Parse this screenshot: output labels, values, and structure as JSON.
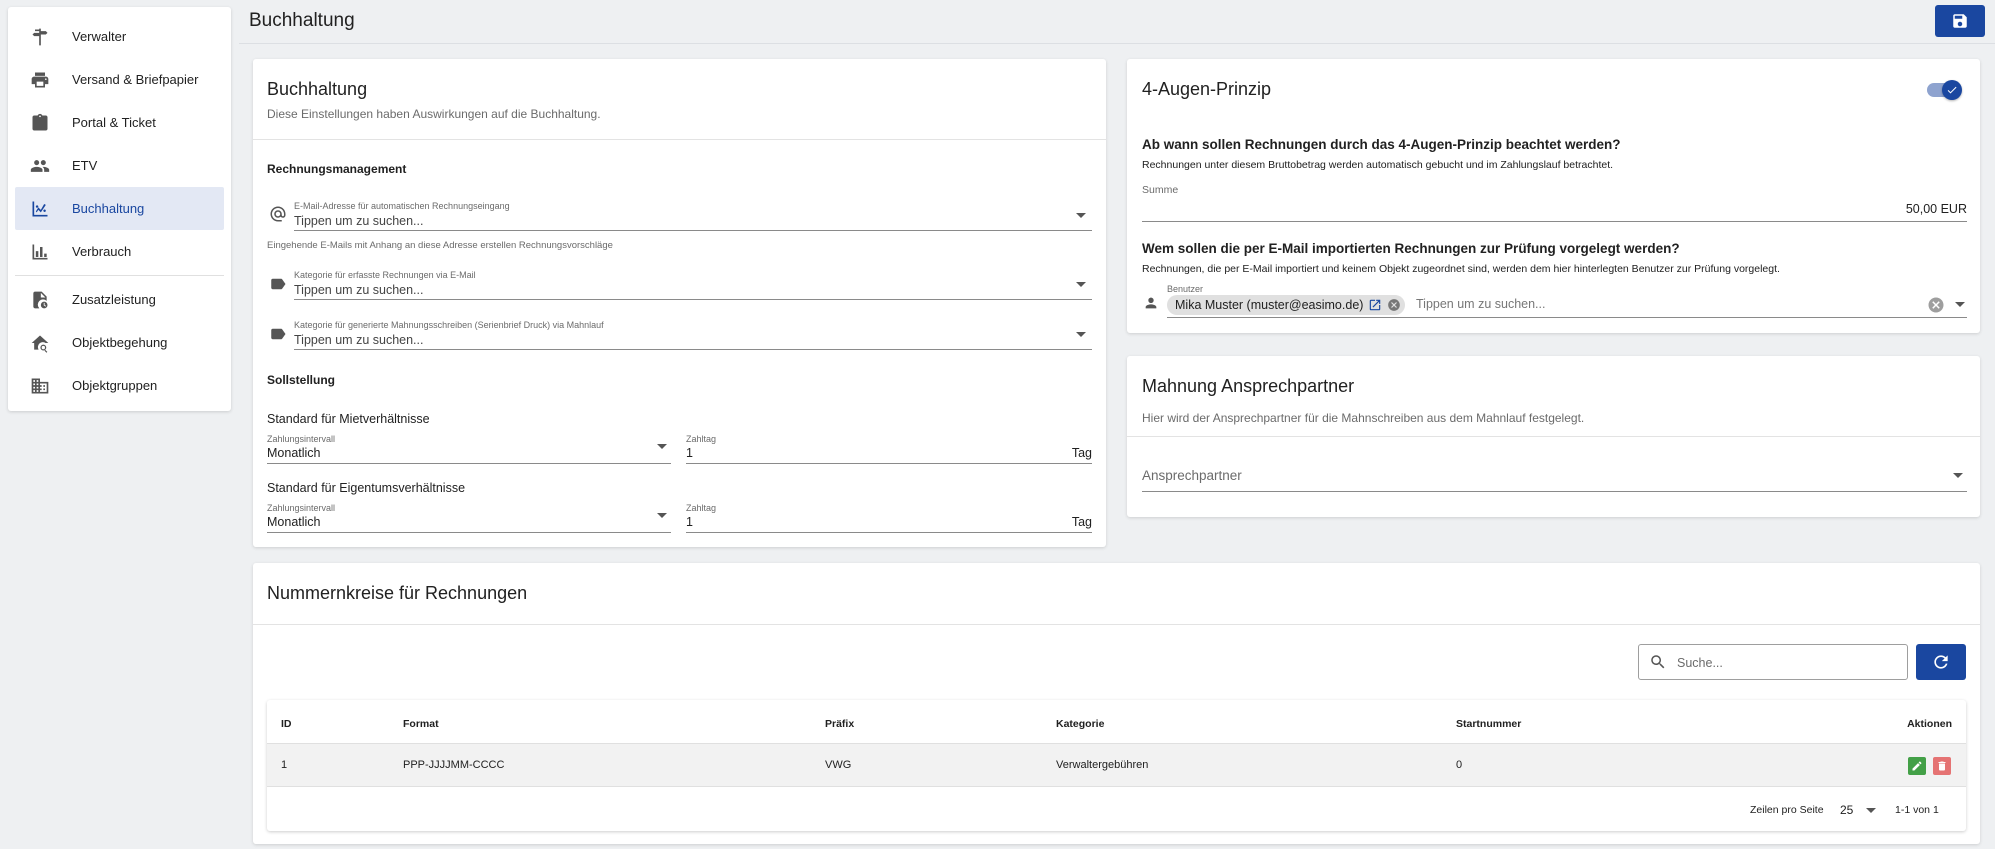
{
  "sidebar": {
    "items": [
      {
        "label": "Verwalter",
        "icon": "signpost-icon"
      },
      {
        "label": "Versand & Briefpapier",
        "icon": "printer-icon"
      },
      {
        "label": "Portal & Ticket",
        "icon": "clipboard-icon"
      },
      {
        "label": "ETV",
        "icon": "group-icon"
      },
      {
        "label": "Buchhaltung",
        "icon": "chart-scatter-icon",
        "active": true
      },
      {
        "label": "Verbrauch",
        "icon": "bar-chart-icon"
      },
      {
        "label": "Zusatzleistung",
        "icon": "document-clock-icon"
      },
      {
        "label": "Objektbegehung",
        "icon": "home-search-icon"
      },
      {
        "label": "Objektgruppen",
        "icon": "buildings-icon"
      }
    ]
  },
  "header": {
    "title": "Buchhaltung",
    "save_icon": "save-icon"
  },
  "buchhaltung": {
    "title": "Buchhaltung",
    "subtitle": "Diese Einstellungen haben Auswirkungen auf die Buchhaltung.",
    "rechnungsmanagement": {
      "title": "Rechnungsmanagement",
      "email_label": "E-Mail-Adresse für automatischen Rechnungseingang",
      "email_placeholder": "Tippen um zu suchen...",
      "email_hint": "Eingehende E-Mails mit Anhang an diese Adresse erstellen Rechnungsvorschläge",
      "kategorie_email_label": "Kategorie für erfasste Rechnungen via E-Mail",
      "kategorie_email_placeholder": "Tippen um zu suchen...",
      "kategorie_mahn_label": "Kategorie für generierte Mahnungsschreiben (Serienbrief Druck) via Mahnlauf",
      "kategorie_mahn_placeholder": "Tippen um zu suchen..."
    },
    "sollstellung": {
      "title": "Sollstellung",
      "miet_title": "Standard für Mietverhältnisse",
      "miet_intervall_label": "Zahlungsintervall",
      "miet_intervall_value": "Monatlich",
      "miet_zahltag_label": "Zahltag",
      "miet_zahltag_value": "1",
      "miet_zahltag_suffix": "Tag",
      "eigen_title": "Standard für Eigentumsverhältnisse",
      "eigen_intervall_label": "Zahlungsintervall",
      "eigen_intervall_value": "Monatlich",
      "eigen_zahltag_label": "Zahltag",
      "eigen_zahltag_value": "1",
      "eigen_zahltag_suffix": "Tag"
    }
  },
  "vier_augen": {
    "title": "4-Augen-Prinzip",
    "enabled": true,
    "q1_title": "Ab wann sollen Rechnungen durch das 4-Augen-Prinzip beachtet werden?",
    "q1_sub": "Rechnungen unter diesem Bruttobetrag werden automatisch gebucht und im Zahlungslauf betrachtet.",
    "summe_label": "Summe",
    "summe_value": "50,00 EUR",
    "q2_title": "Wem sollen die per E-Mail importierten Rechnungen zur Prüfung vorgelegt werden?",
    "q2_sub": "Rechnungen, die per E-Mail importiert und keinem Objekt zugeordnet sind, werden dem hier hinterlegten Benutzer zur Prüfung vorgelegt.",
    "benutzer_label": "Benutzer",
    "benutzer_chip": "Mika Muster (muster@easimo.de)",
    "benutzer_placeholder": "Tippen um zu suchen..."
  },
  "mahnung": {
    "title": "Mahnung Ansprechpartner",
    "subtitle": "Hier wird der Ansprechpartner für die Mahnschreiben aus dem Mahnlauf festgelegt.",
    "field_placeholder": "Ansprechpartner"
  },
  "nummernkreise": {
    "title": "Nummernkreise für Rechnungen",
    "search_placeholder": "Suche...",
    "columns": [
      "ID",
      "Format",
      "Präfix",
      "Kategorie",
      "Startnummer",
      "Aktionen"
    ],
    "rows": [
      {
        "id": "1",
        "format": "PPP-JJJJMM-CCCC",
        "praefix": "VWG",
        "kategorie": "Verwaltergebühren",
        "startnummer": "0"
      }
    ],
    "footer": {
      "rows_per_page_label": "Zeilen pro Seite",
      "rows_per_page": "25",
      "range": "1-1 von 1"
    }
  },
  "colors": {
    "primary": "#1a47a0",
    "edit": "#43a047",
    "delete": "#e57373"
  }
}
